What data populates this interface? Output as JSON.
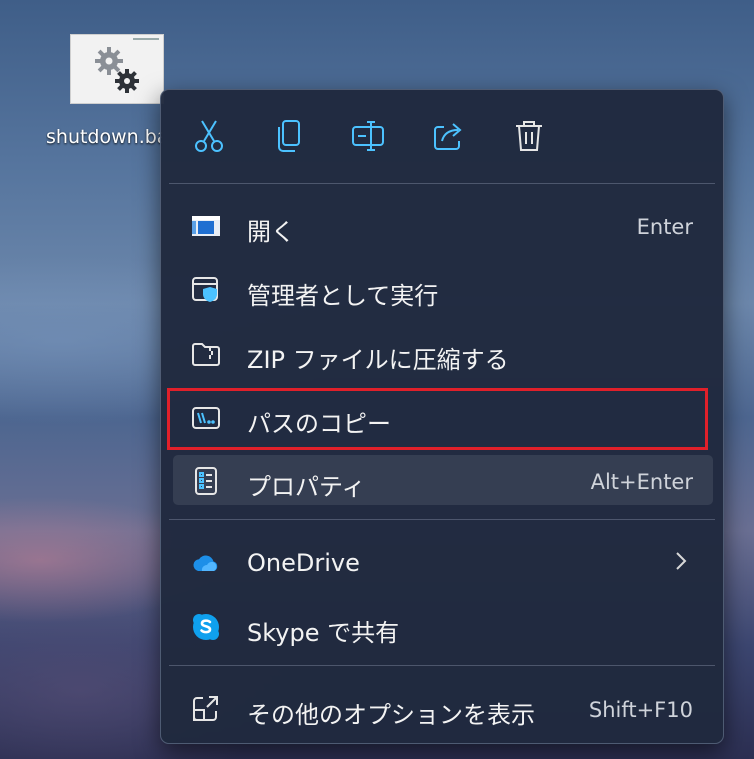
{
  "desktop": {
    "icon_label": "shutdown.bat"
  },
  "toolbar": {
    "cut": "cut-icon",
    "copy": "copy-icon",
    "rename": "rename-icon",
    "share": "share-icon",
    "delete": "delete-icon"
  },
  "menu": {
    "items": [
      {
        "label": "開く",
        "shortcut": "Enter",
        "icon": "open-app-icon"
      },
      {
        "label": "管理者として実行",
        "shortcut": "",
        "icon": "run-as-admin-icon"
      },
      {
        "label": "ZIP ファイルに圧縮する",
        "shortcut": "",
        "icon": "zip-folder-icon"
      },
      {
        "label": "パスのコピー",
        "shortcut": "",
        "icon": "copy-path-icon"
      },
      {
        "label": "プロパティ",
        "shortcut": "Alt+Enter",
        "icon": "properties-icon"
      },
      {
        "label": "OneDrive",
        "shortcut": "",
        "icon": "onedrive-icon"
      },
      {
        "label": "Skype で共有",
        "shortcut": "",
        "icon": "skype-icon"
      },
      {
        "label": "その他のオプションを表示",
        "shortcut": "Shift+F10",
        "icon": "more-options-icon"
      }
    ]
  },
  "colors": {
    "accent": "#4cc2ff",
    "highlight_border": "#e0202a",
    "menu_bg": "#20293e"
  }
}
